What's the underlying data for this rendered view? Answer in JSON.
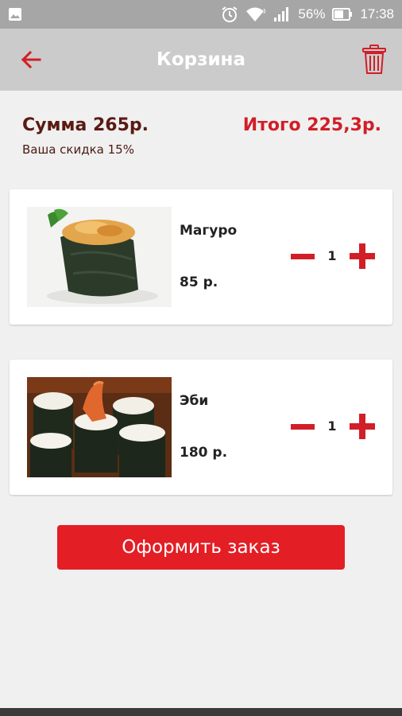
{
  "status_bar": {
    "battery_percent": "56%",
    "time": "17:38",
    "icons": [
      "image-icon",
      "alarm-icon",
      "wifi-icon",
      "signal-icon",
      "battery-icon"
    ]
  },
  "app_bar": {
    "title": "Корзина",
    "back_icon": "arrow-left-icon",
    "delete_icon": "trash-icon"
  },
  "summary": {
    "sum_label": "Сумма 265р.",
    "discount_label": "Ваша скидка 15%",
    "total_label": "Итого 225,3р."
  },
  "items": [
    {
      "name": "Магуро",
      "price": "85 р.",
      "quantity": "1"
    },
    {
      "name": "Эби",
      "price": "180 р.",
      "quantity": "1"
    }
  ],
  "order_button_label": "Оформить заказ",
  "colors": {
    "accent": "#e31e25",
    "status_bar": "#a6a6a6",
    "app_bar": "#cbcbcb",
    "background": "#f0f0f0",
    "sum_text": "#5a1a12"
  }
}
